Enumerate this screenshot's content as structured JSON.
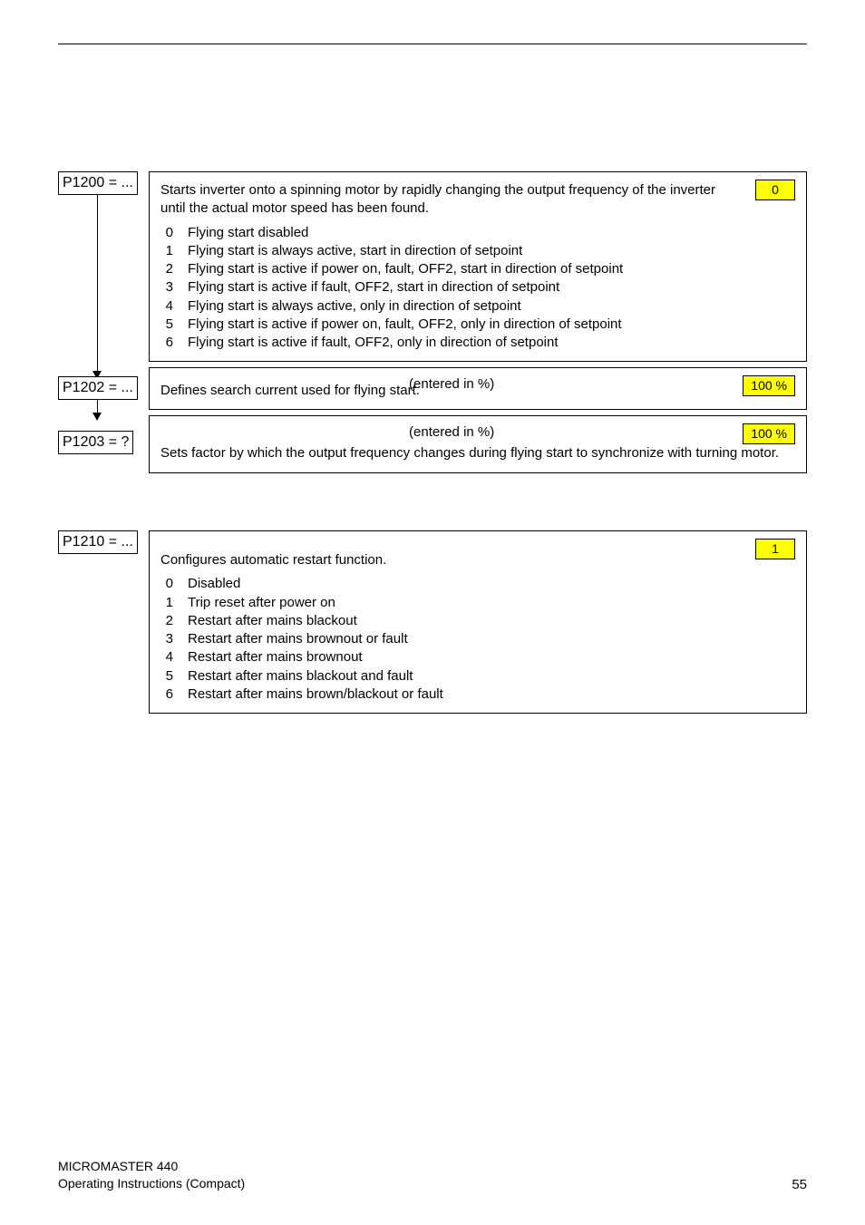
{
  "params": {
    "p1200": {
      "label": "P1200 = ..."
    },
    "p1202": {
      "label": "P1202 = ..."
    },
    "p1203": {
      "label": "P1203 = ?"
    },
    "p1210": {
      "label": "P1210 = ..."
    }
  },
  "cards": {
    "flyingStart": {
      "badge": "0",
      "intro": "Starts inverter onto a spinning motor by rapidly changing the output frequency of the inverter until the actual motor speed has been found.",
      "options": [
        {
          "n": "0",
          "t": "Flying start disabled"
        },
        {
          "n": "1",
          "t": "Flying start is always active, start in direction of setpoint"
        },
        {
          "n": "2",
          "t": "Flying start is active if power on, fault, OFF2, start in direction of setpoint"
        },
        {
          "n": "3",
          "t": "Flying start is active if fault, OFF2, start in direction of setpoint"
        },
        {
          "n": "4",
          "t": "Flying start is always active, only in direction of setpoint"
        },
        {
          "n": "5",
          "t": "Flying start is active if power on, fault, OFF2, only in direction of setpoint"
        },
        {
          "n": "6",
          "t": "Flying start is active if fault, OFF2, only in direction of setpoint"
        }
      ]
    },
    "searchCurrent": {
      "centerLabel": "(entered in %)",
      "badge": "100 %",
      "desc": "Defines search current used for flying start."
    },
    "rateFactor": {
      "centerLabel": "(entered in %)",
      "badge": "100 %",
      "desc": "Sets factor by which the output frequency changes during flying start to synchronize with turning motor."
    },
    "autoRestart": {
      "badge": "1",
      "intro": "Configures automatic restart function.",
      "options": [
        {
          "n": "0",
          "t": "Disabled"
        },
        {
          "n": "1",
          "t": "Trip reset after power on"
        },
        {
          "n": "2",
          "t": "Restart after mains blackout"
        },
        {
          "n": "3",
          "t": "Restart after mains brownout or fault"
        },
        {
          "n": "4",
          "t": "Restart after mains brownout"
        },
        {
          "n": "5",
          "t": "Restart after mains blackout and fault"
        },
        {
          "n": "6",
          "t": "Restart after mains brown/blackout or fault"
        }
      ]
    }
  },
  "footer": {
    "line1": "MICROMASTER 440",
    "line2": "Operating Instructions (Compact)",
    "page": "55"
  }
}
